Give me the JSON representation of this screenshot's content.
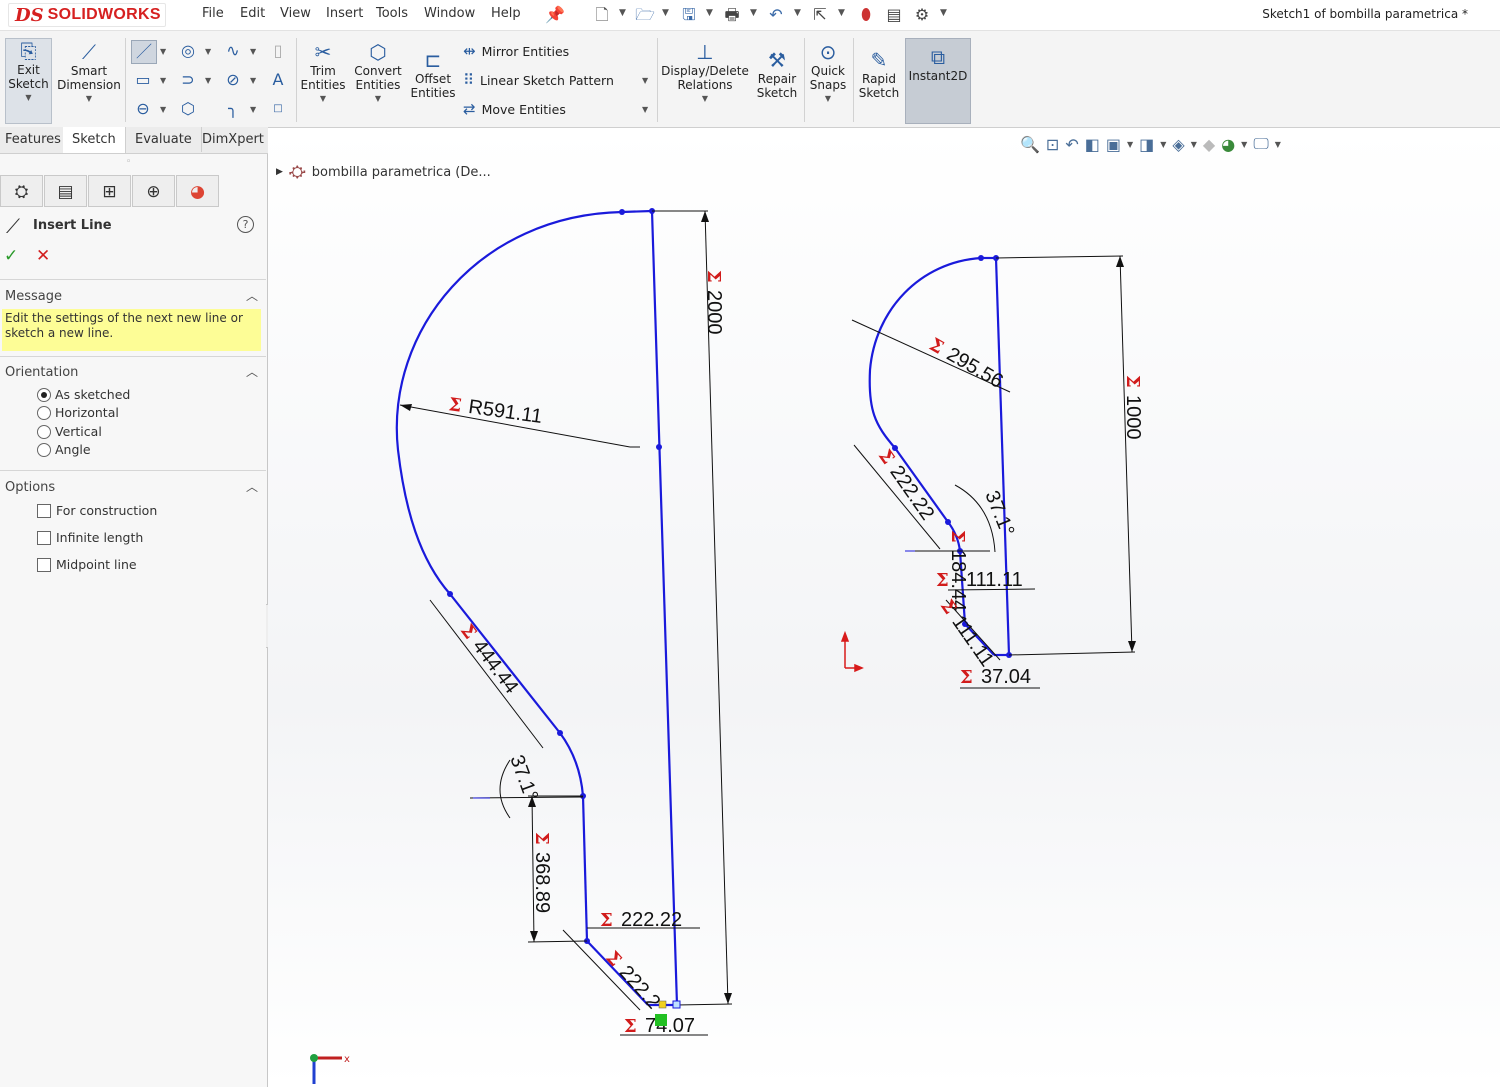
{
  "app": {
    "logo_ds": "DS",
    "logo_name": "SOLIDWORKS"
  },
  "menu": [
    "File",
    "Edit",
    "View",
    "Insert",
    "Tools",
    "Window",
    "Help"
  ],
  "document_title": "Sketch1 of bombilla parametrica *",
  "toolbar": {
    "exit_sketch": "Exit\nSketch",
    "smart_dimension": "Smart\nDimension",
    "trim_entities": "Trim\nEntities",
    "convert_entities": "Convert\nEntities",
    "offset_entities": "Offset\nEntities",
    "mirror_entities": "Mirror Entities",
    "linear_sketch_pattern": "Linear Sketch Pattern",
    "move_entities": "Move Entities",
    "display_delete_relations": "Display/Delete\nRelations",
    "repair_sketch": "Repair\nSketch",
    "quick_snaps": "Quick\nSnaps",
    "rapid_sketch": "Rapid\nSketch",
    "instant2d": "Instant2D"
  },
  "tabs": [
    "Features",
    "Sketch",
    "Evaluate",
    "DimXpert"
  ],
  "active_tab": "Sketch",
  "property_manager": {
    "title": "Insert Line",
    "message_header": "Message",
    "message_text": "Edit the settings of the next new line or sketch a new line.",
    "orientation_header": "Orientation",
    "orientation_options": [
      "As sketched",
      "Horizontal",
      "Vertical",
      "Angle"
    ],
    "orientation_selected": "As sketched",
    "options_header": "Options",
    "options": [
      "For construction",
      "Infinite length",
      "Midpoint line"
    ]
  },
  "feature_tree": {
    "item": "bombilla parametrica  (De..."
  },
  "dimensions": {
    "big_height": "2000",
    "big_radius": "R591.11",
    "big_line": "444.44",
    "big_angle": "37.1°",
    "big_vertical": "368.89",
    "big_horizontal": "222.22",
    "big_diag": "222.2",
    "big_bottom": "74.07",
    "small_height": "1000",
    "small_radius": "295.56",
    "small_line": "222.22",
    "small_angle": "37.1°",
    "small_vertical": "184.44",
    "small_horizontal": "111.11",
    "small_diag": "111.11",
    "small_bottom": "37.04",
    "sigma": "Σ"
  },
  "colors": {
    "sketch": "#1a1adb",
    "sigma": "#d11b1b",
    "highlight": "#fdfd96"
  }
}
